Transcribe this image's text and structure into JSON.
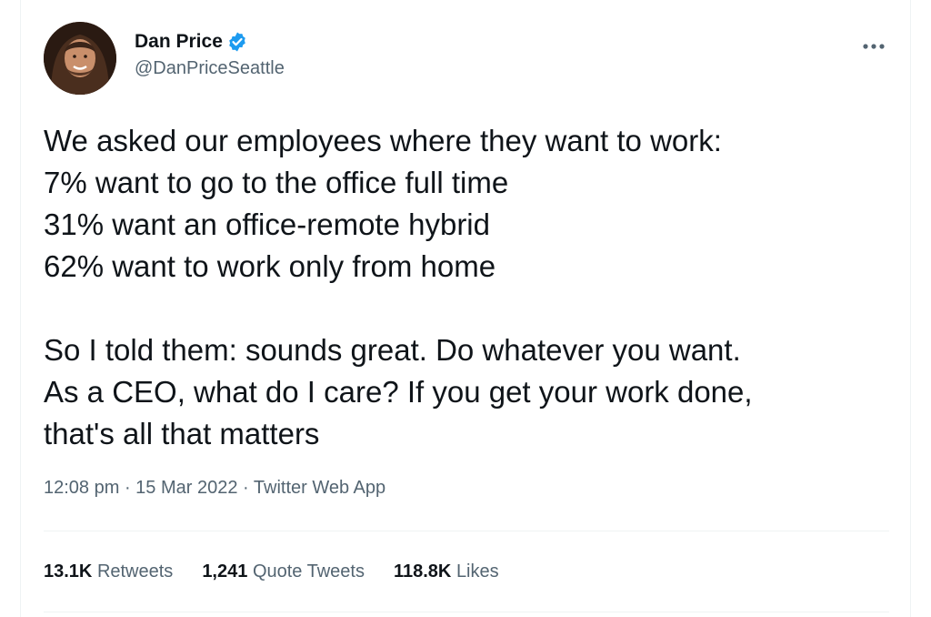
{
  "author": {
    "display_name": "Dan Price",
    "handle": "@DanPriceSeattle",
    "verified": true
  },
  "tweet": {
    "text": "We asked our employees where they want to work:\n7% want to go to the office full time\n31% want an office-remote hybrid\n62% want to work only from home\n\nSo I told them: sounds great. Do whatever you want.\nAs a CEO, what do I care? If you get your work done,\nthat's all that matters",
    "time": "12:08 pm",
    "separator_1": " · ",
    "date": "15 Mar 2022",
    "separator_2": " · ",
    "source": "Twitter Web App"
  },
  "stats": {
    "retweets_count": "13.1K",
    "retweets_label": "Retweets",
    "quotes_count": "1,241",
    "quotes_label": "Quote Tweets",
    "likes_count": "118.8K",
    "likes_label": "Likes"
  },
  "icons": {
    "verified": "verified-badge-icon",
    "more": "more-options-icon"
  },
  "colors": {
    "primary_text": "#0f1419",
    "secondary_text": "#536471",
    "verified_blue": "#1d9bf0",
    "divider": "#eff3f4"
  }
}
